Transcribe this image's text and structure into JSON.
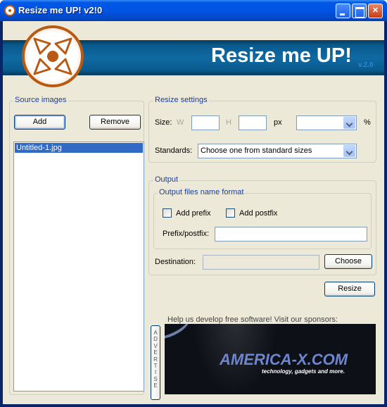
{
  "window": {
    "title": "Resize me UP! v2!0",
    "controls": [
      "minimize",
      "maximize",
      "close"
    ]
  },
  "banner": {
    "title": "Resize me UP!",
    "version": "v.2.0",
    "colors": {
      "band": "#0f6aa3",
      "logo": "#b95a12"
    }
  },
  "source": {
    "group_label": "Source images",
    "add_label": "Add",
    "remove_label": "Remove",
    "files": [
      "Untitled-1.jpg"
    ]
  },
  "resize": {
    "group_label": "Resize settings",
    "size_label": "Size:",
    "w_label": "W",
    "h_label": "H",
    "width_value": "",
    "height_value": "",
    "px_label": "px",
    "percent_value": "",
    "percent_label": "%",
    "standards_label": "Standards:",
    "standards_value": "Choose one from standard sizes"
  },
  "output": {
    "group_label": "Output",
    "format_group_label": "Output files name format",
    "add_prefix_label": "Add prefix",
    "add_prefix_checked": false,
    "add_postfix_label": "Add postfix",
    "add_postfix_checked": false,
    "prefix_postfix_label": "Prefix/postfix:",
    "prefix_postfix_value": "",
    "destination_label": "Destination:",
    "destination_value": "",
    "choose_label": "Choose"
  },
  "actions": {
    "resize_label": "Resize"
  },
  "sponsors": {
    "text": "Help us develop free software! Visit our sponsors:",
    "advertise_label": "ADVERTISE",
    "ad_title": "AMERICA-X.COM",
    "ad_subtitle": "technology, gadgets and more."
  }
}
